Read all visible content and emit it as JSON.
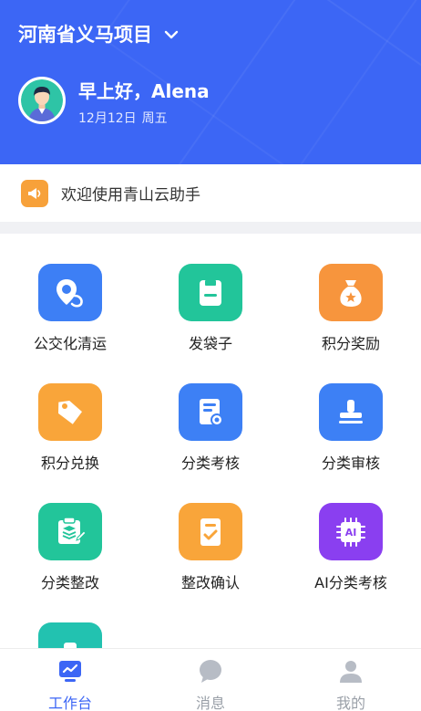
{
  "header": {
    "project_name": "河南省义马项目",
    "greeting": "早上好，Alena",
    "date": "12月12日",
    "weekday": "周五",
    "bg_color": "#3c66f5"
  },
  "notice": {
    "text": "欢迎使用青山云助手",
    "icon": "megaphone-icon"
  },
  "grid": [
    {
      "label": "公交化清运",
      "icon": "location-pin-icon",
      "color": "#3d7ff5"
    },
    {
      "label": "发袋子",
      "icon": "bag-icon",
      "color": "#22c59a"
    },
    {
      "label": "积分奖励",
      "icon": "money-bag-icon",
      "color": "#f7953d"
    },
    {
      "label": "积分兑换",
      "icon": "tag-icon",
      "color": "#f9a53a"
    },
    {
      "label": "分类考核",
      "icon": "certificate-icon",
      "color": "#3d80f5"
    },
    {
      "label": "分类审核",
      "icon": "stamp-icon",
      "color": "#3d80f5"
    },
    {
      "label": "分类整改",
      "icon": "clipboard-edit-icon",
      "color": "#22c59a"
    },
    {
      "label": "整改确认",
      "icon": "checklist-icon",
      "color": "#f9a53a"
    },
    {
      "label": "AI分类考核",
      "icon": "ai-chip-icon",
      "color": "#8a3ff0"
    },
    {
      "label": "",
      "icon": "partial-tile-icon",
      "color": "#22c2b0"
    }
  ],
  "tabbar": [
    {
      "label": "工作台",
      "icon": "workbench-icon",
      "active": true
    },
    {
      "label": "消息",
      "icon": "message-icon",
      "active": false
    },
    {
      "label": "我的",
      "icon": "user-icon",
      "active": false
    }
  ]
}
